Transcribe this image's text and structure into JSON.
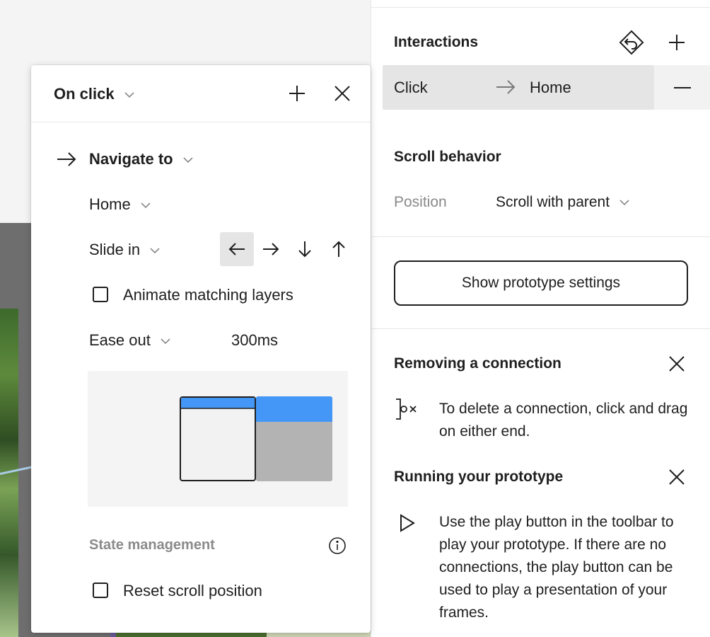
{
  "colors": {
    "accent_blue": "#4597f7",
    "panel_bg": "#ffffff",
    "row_selected": "#e5e5e5",
    "muted_text": "#8a8a8a"
  },
  "interactions": {
    "title": "Interactions",
    "reverse_icon": "reverse-interaction-icon",
    "add_icon": "plus-icon",
    "row": {
      "trigger": "Click",
      "destination": "Home"
    },
    "remove_icon": "minus-icon"
  },
  "scroll_behavior": {
    "title": "Scroll behavior",
    "position_label": "Position",
    "position_value": "Scroll with parent"
  },
  "prototype_settings_button": "Show prototype settings",
  "tips": [
    {
      "title": "Removing a connection",
      "icon": "connection-remove-icon",
      "text": "To delete a connection, click and drag on either end."
    },
    {
      "title": "Running your prototype",
      "icon": "play-icon",
      "text": "Use the play button in the toolbar to play your prototype. If there are no connections, the play button can be used to play a presentation of your frames."
    }
  ],
  "popover": {
    "trigger": "On click",
    "action": "Navigate to",
    "destination": "Home",
    "animation": "Slide in",
    "directions": [
      {
        "icon": "arrow-left-icon",
        "active": true
      },
      {
        "icon": "arrow-right-icon",
        "active": false
      },
      {
        "icon": "arrow-down-icon",
        "active": false
      },
      {
        "icon": "arrow-up-icon",
        "active": false
      }
    ],
    "animate_matching_layers": {
      "label": "Animate matching layers",
      "checked": false
    },
    "easing": "Ease out",
    "duration": "300ms",
    "state_management": "State management",
    "reset_scroll_position": {
      "label": "Reset scroll position",
      "checked": false
    }
  }
}
